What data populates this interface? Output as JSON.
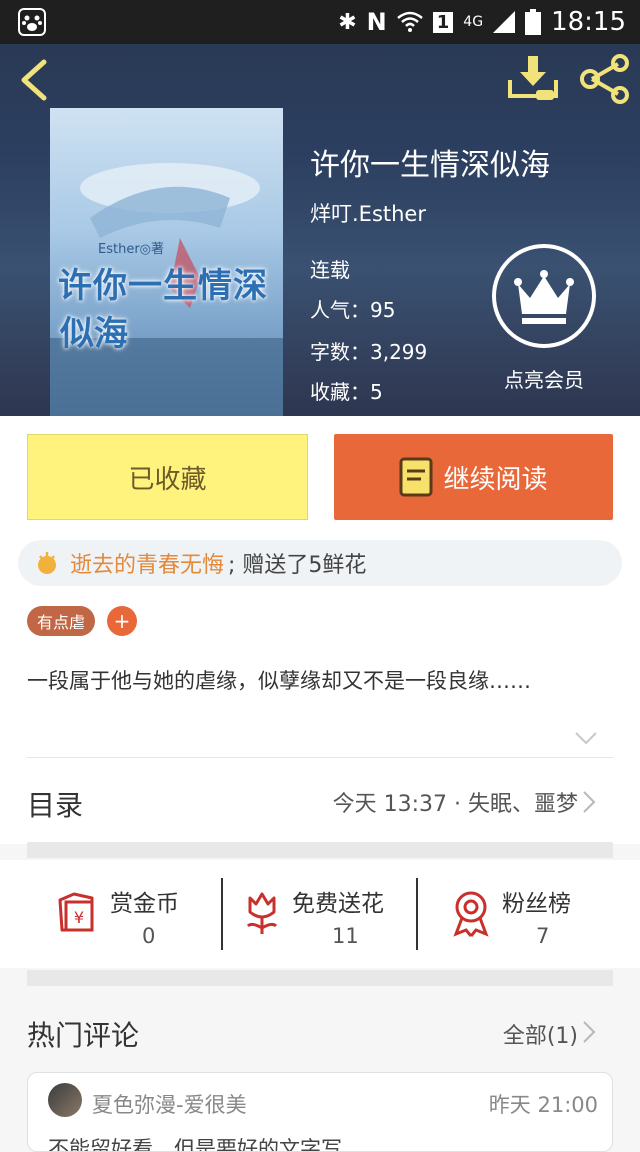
{
  "status_bar": {
    "time": "18:15",
    "network": "4G",
    "sim": "1"
  },
  "book": {
    "title": "许你一生情深似海",
    "author": "烊叮.Esther",
    "status": "连载",
    "popularity": "人气：95",
    "word_count": "字数：3,299",
    "favorites": "收藏：5",
    "cover_title_line1": "许你一生情深",
    "cover_title_line2": "似海",
    "cover_author": "Esther◎著"
  },
  "vip": {
    "label": "点亮会员"
  },
  "actions": {
    "favorited": "已收藏",
    "continue_reading": "继续阅读"
  },
  "gift_banner": {
    "user": "逝去的青春无悔",
    "message": "; 赠送了5鲜花"
  },
  "tags": [
    "有点虐"
  ],
  "add_tag": "+",
  "description": "一段属于他与她的虐缘，似孽缘却又不是一段良缘……",
  "toc": {
    "label": "目录",
    "latest": "今天 13:37 · 失眠、噩梦"
  },
  "stats": [
    {
      "label": "赏金币",
      "value": "0",
      "icon": "reward-coin-icon"
    },
    {
      "label": "免费送花",
      "value": "11",
      "icon": "flower-icon"
    },
    {
      "label": "粉丝榜",
      "value": "7",
      "icon": "ribbon-icon"
    }
  ],
  "comments": {
    "title": "热门评论",
    "all": "全部(1)",
    "items": [
      {
        "user": "夏色弥漫-爱很美",
        "time": "昨天 21:00",
        "text": "不能留好看，但是要好的文字写"
      }
    ]
  },
  "colors": {
    "accent": "#e8683a",
    "fav_bg": "#fff27d",
    "gift_user": "#e28a3b",
    "icon_red": "#c9302c"
  }
}
